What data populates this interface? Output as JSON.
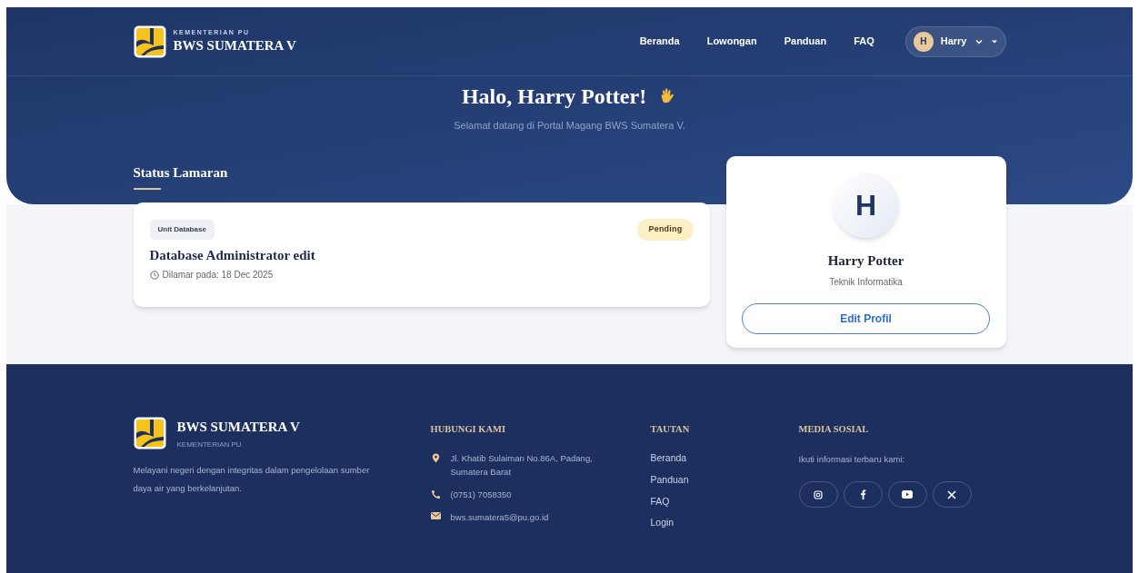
{
  "brand": {
    "ministry": "KEMENTERIAN PU",
    "name": "BWS SUMATERA V"
  },
  "nav": [
    {
      "label": "Beranda"
    },
    {
      "label": "Lowongan"
    },
    {
      "label": "Panduan"
    },
    {
      "label": "FAQ"
    }
  ],
  "user_menu": {
    "initial": "H",
    "name": "Harry"
  },
  "greeting": {
    "title": "Halo, Harry Potter!",
    "subtitle": "Selamat datang di Portal Magang BWS Sumatera V."
  },
  "applications": {
    "heading": "Status Lamaran",
    "items": [
      {
        "unit": "Unit Database",
        "status": "Pending",
        "position": "Database Administrator edit",
        "applied": "Dilamar pada: 18 Dec 2025"
      }
    ]
  },
  "profile": {
    "initial": "H",
    "name": "Harry Potter",
    "major": "Teknik Informatika",
    "button": "Edit Profil"
  },
  "footer": {
    "name": "BWS SUMATERA V",
    "ministry": "KEMENTERIAN PU",
    "description": "Melayani negeri dengan integritas dalam pengelolaan sumber daya air yang berkelanjutan.",
    "contact": {
      "heading": "HUBUNGI KAMI",
      "items": [
        {
          "kind": "address",
          "text": "Jl. Khatib Sulaiman No.86A, Padang, Sumatera Barat"
        },
        {
          "kind": "phone",
          "text": "(0751) 7058350"
        },
        {
          "kind": "email",
          "text": "bws.sumatera5@pu.go.id"
        }
      ]
    },
    "links": {
      "heading": "TAUTAN",
      "items": [
        "Beranda",
        "Panduan",
        "FAQ",
        "Login"
      ]
    },
    "social": {
      "heading": "MEDIA SOSIAL",
      "text": "Ikuti informasi terbaru kami:"
    }
  }
}
